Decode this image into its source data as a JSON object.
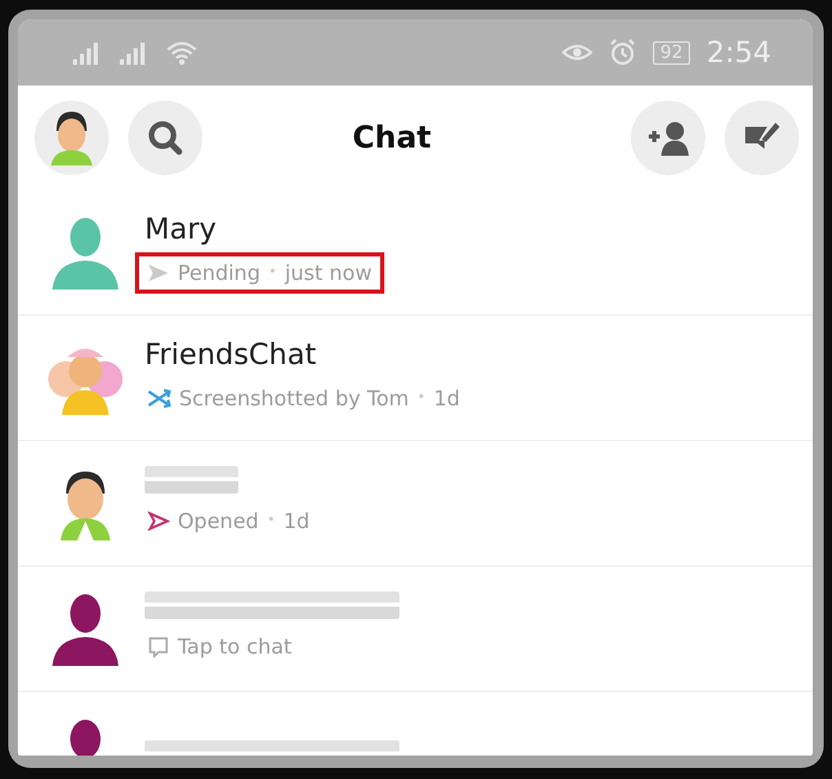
{
  "status_bar": {
    "battery": "92",
    "time": "2:54"
  },
  "header": {
    "title": "Chat"
  },
  "chats": [
    {
      "avatar": {
        "kind": "silhouette",
        "color": "#5cc4a6"
      },
      "name": "Mary",
      "status": {
        "kind": "pending",
        "text": "Pending",
        "separator": "•",
        "time": "just now"
      },
      "highlighted": true
    },
    {
      "avatar": {
        "kind": "group"
      },
      "name": "FriendsChat",
      "status": {
        "kind": "screenshot",
        "text": "Screenshotted by Tom",
        "separator": "•",
        "time": "1d"
      }
    },
    {
      "avatar": {
        "kind": "figure"
      },
      "name_redacted": true,
      "status": {
        "kind": "opened",
        "text": "Opened",
        "separator": "•",
        "time": "1d"
      }
    },
    {
      "avatar": {
        "kind": "silhouette",
        "color": "#8c1660"
      },
      "name_redacted": true,
      "status": {
        "kind": "tap",
        "text": "Tap to chat"
      }
    },
    {
      "avatar": {
        "kind": "silhouette",
        "color": "#8c1660"
      },
      "name_redacted": true
    }
  ]
}
